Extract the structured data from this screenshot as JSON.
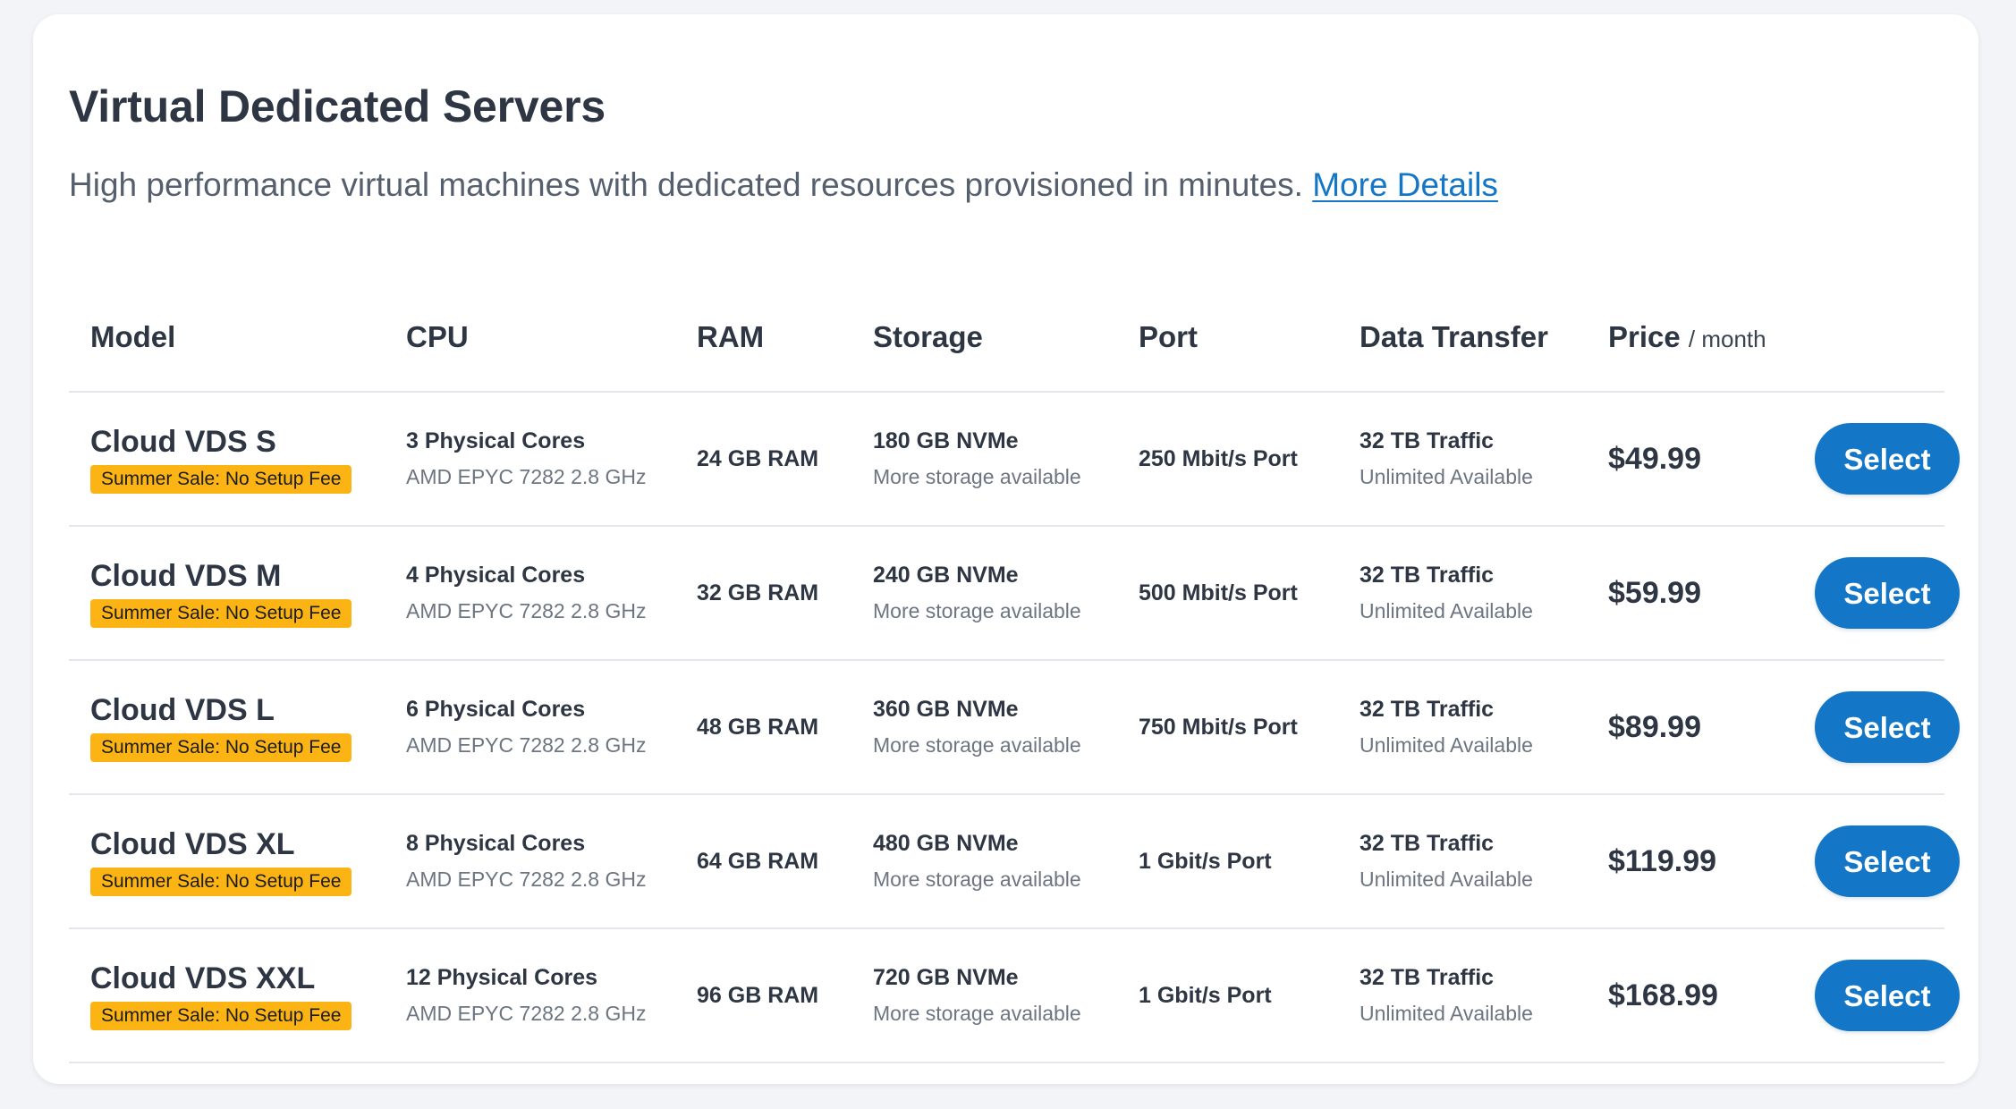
{
  "section": {
    "title": "Virtual Dedicated Servers",
    "description": "High performance virtual machines with dedicated resources provisioned in minutes.",
    "more_details_link": "More Details"
  },
  "table": {
    "headers": {
      "model": "Model",
      "cpu": "CPU",
      "ram": "RAM",
      "storage": "Storage",
      "port": "Port",
      "data_transfer": "Data Transfer",
      "price": "Price",
      "price_unit": "/ month"
    },
    "rows": [
      {
        "model": "Cloud VDS S",
        "badge": "Summer Sale: No Setup Fee",
        "cpu": "3 Physical Cores",
        "cpu_detail": "AMD EPYC 7282 2.8 GHz",
        "ram": "24 GB RAM",
        "storage": "180 GB NVMe",
        "storage_detail": "More storage available",
        "port": "250 Mbit/s Port",
        "traffic": "32 TB Traffic",
        "traffic_detail": "Unlimited Available",
        "price": "$49.99",
        "button": "Select"
      },
      {
        "model": "Cloud VDS M",
        "badge": "Summer Sale: No Setup Fee",
        "cpu": "4 Physical Cores",
        "cpu_detail": "AMD EPYC 7282 2.8 GHz",
        "ram": "32 GB RAM",
        "storage": "240 GB NVMe",
        "storage_detail": "More storage available",
        "port": "500 Mbit/s Port",
        "traffic": "32 TB Traffic",
        "traffic_detail": "Unlimited Available",
        "price": "$59.99",
        "button": "Select"
      },
      {
        "model": "Cloud VDS L",
        "badge": "Summer Sale: No Setup Fee",
        "cpu": "6 Physical Cores",
        "cpu_detail": "AMD EPYC 7282 2.8 GHz",
        "ram": "48 GB RAM",
        "storage": "360 GB NVMe",
        "storage_detail": "More storage available",
        "port": "750 Mbit/s Port",
        "traffic": "32 TB Traffic",
        "traffic_detail": "Unlimited Available",
        "price": "$89.99",
        "button": "Select"
      },
      {
        "model": "Cloud VDS XL",
        "badge": "Summer Sale: No Setup Fee",
        "cpu": "8 Physical Cores",
        "cpu_detail": "AMD EPYC 7282 2.8 GHz",
        "ram": "64 GB RAM",
        "storage": "480 GB NVMe",
        "storage_detail": "More storage available",
        "port": "1 Gbit/s Port",
        "traffic": "32 TB Traffic",
        "traffic_detail": "Unlimited Available",
        "price": "$119.99",
        "button": "Select"
      },
      {
        "model": "Cloud VDS XXL",
        "badge": "Summer Sale: No Setup Fee",
        "cpu": "12 Physical Cores",
        "cpu_detail": "AMD EPYC 7282 2.8 GHz",
        "ram": "96 GB RAM",
        "storage": "720 GB NVMe",
        "storage_detail": "More storage available",
        "port": "1 Gbit/s Port",
        "traffic": "32 TB Traffic",
        "traffic_detail": "Unlimited Available",
        "price": "$168.99",
        "button": "Select"
      }
    ]
  },
  "colors": {
    "page_background": "#f3f4f7",
    "card_background": "#ffffff",
    "primary_button": "#1476c6",
    "link": "#1476c6",
    "sale_badge": "#fbb414",
    "heading_text": "#2d3642",
    "muted_text": "#6c7581"
  }
}
